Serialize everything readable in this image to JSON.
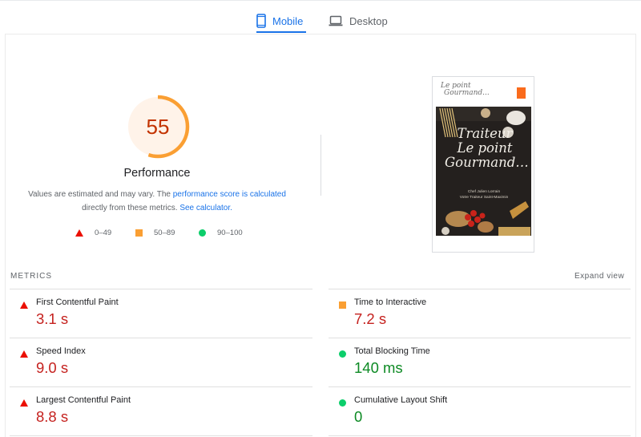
{
  "tabs": [
    {
      "label": "Mobile",
      "active": true,
      "icon": "smartphone-icon"
    },
    {
      "label": "Desktop",
      "active": false,
      "icon": "laptop-icon"
    }
  ],
  "performance": {
    "score": "55",
    "score_value": 55,
    "title": "Performance",
    "description_1": "Values are estimated and may vary. The ",
    "description_link_1": "performance score is calculated",
    "description_2": "directly from these metrics. ",
    "description_link_2": "See calculator."
  },
  "legend": [
    {
      "label": "0–49",
      "icon": "red-triangle-icon"
    },
    {
      "label": "50–89",
      "icon": "orange-square-icon"
    },
    {
      "label": "90–100",
      "icon": "green-circle-icon"
    }
  ],
  "screenshot": {
    "logo_text_1": "Le point",
    "logo_text_2": "Gourmand...",
    "hero_title_1": "Traiteur",
    "hero_title_2": "Le point",
    "hero_title_3": "Gourmand…",
    "hero_sub_1": "Chef Julien Lorrain",
    "hero_sub_2": "Votre Traiteur Saint-Maximin"
  },
  "metrics": {
    "title": "METRICS",
    "expand_label": "Expand view",
    "items": [
      {
        "label": "First Contentful Paint",
        "value": "3.1 s",
        "status": "poor"
      },
      {
        "label": "Time to Interactive",
        "value": "7.2 s",
        "status": "average"
      },
      {
        "label": "Speed Index",
        "value": "9.0 s",
        "status": "poor"
      },
      {
        "label": "Total Blocking Time",
        "value": "140 ms",
        "status": "good"
      },
      {
        "label": "Largest Contentful Paint",
        "value": "8.8 s",
        "status": "poor"
      },
      {
        "label": "Cumulative Layout Shift",
        "value": "0",
        "status": "good"
      }
    ]
  },
  "colors": {
    "accent": "#1a73e8",
    "poor": "#c5221f",
    "average": "#fa9f33",
    "good": "#0cce6b",
    "gauge_fill": "#fff3e9"
  }
}
